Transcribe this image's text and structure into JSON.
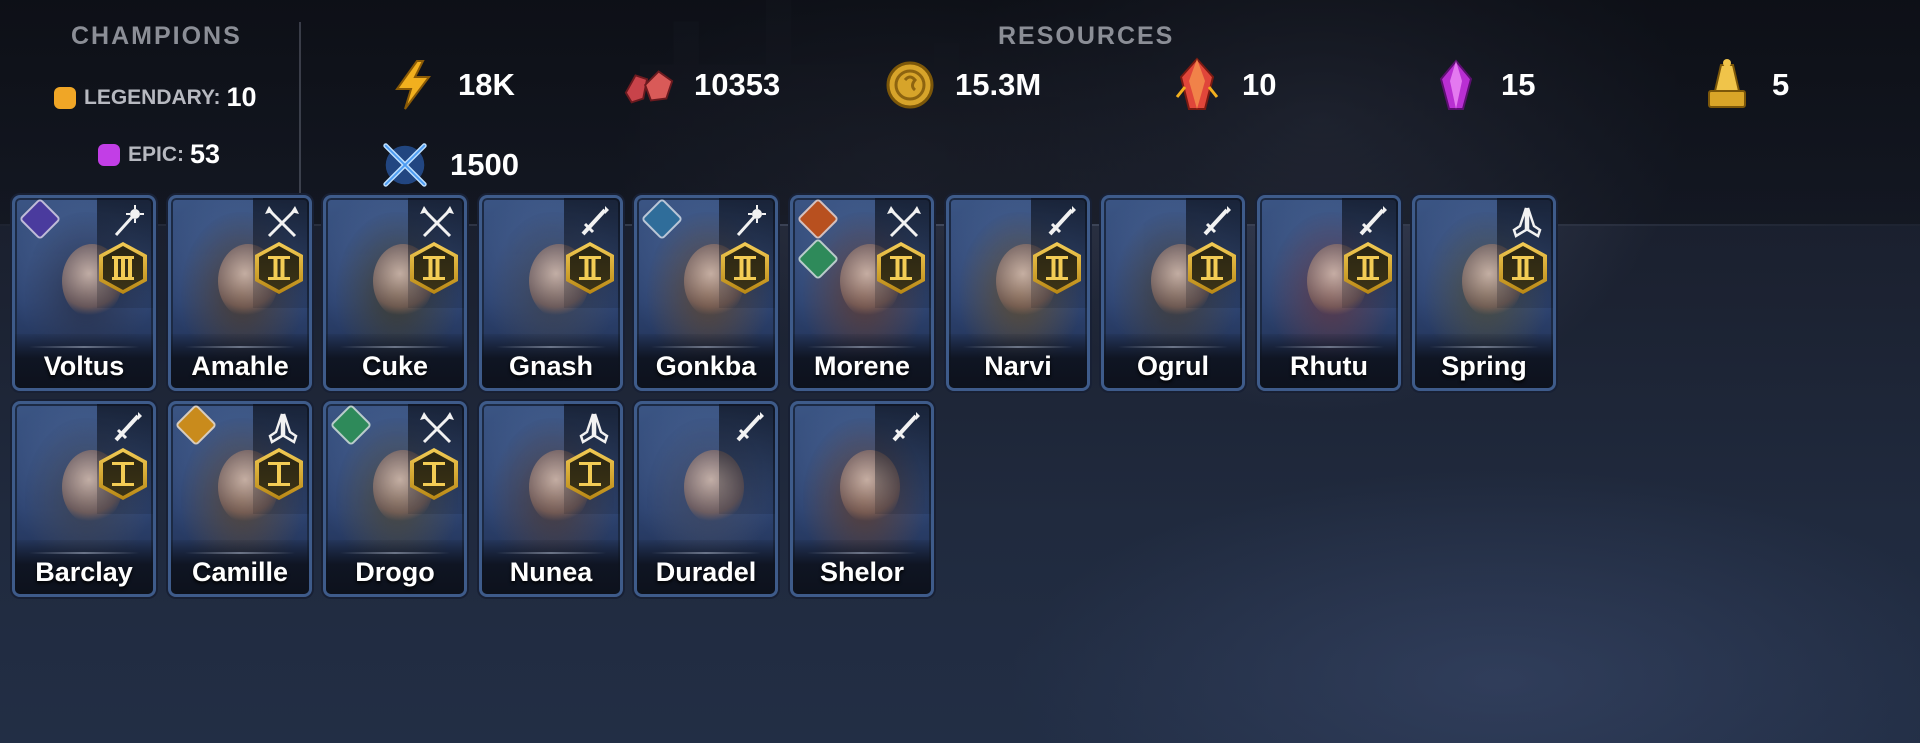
{
  "champions": {
    "title": "CHAMPIONS",
    "legendary": {
      "label": "LEGENDARY:",
      "count": "10",
      "color": "#f0a626"
    },
    "epic": {
      "label": "EPIC:",
      "count": "53",
      "color": "#c23ee6"
    }
  },
  "resources": {
    "title": "RESOURCES",
    "items": [
      {
        "name": "energy",
        "icon": "lightning-icon",
        "value": "18K"
      },
      {
        "name": "rubies",
        "icon": "ruby-icon",
        "value": "10353"
      },
      {
        "name": "silver",
        "icon": "coin-icon",
        "value": "15.3M"
      },
      {
        "name": "red-forge-shard",
        "icon": "red-crystal-icon",
        "value": "10"
      },
      {
        "name": "purple-shard",
        "icon": "purple-crystal-icon",
        "value": "15"
      },
      {
        "name": "gold-item",
        "icon": "gold-trophy-icon",
        "value": "5"
      },
      {
        "name": "arena-tokens",
        "icon": "crossed-swords-icon",
        "value": "1500"
      }
    ]
  },
  "roster": [
    {
      "name": "Voltus",
      "class": "wand-icon",
      "rank": "III",
      "affinity": "magic",
      "affinity2": null,
      "tint": "#27304a"
    },
    {
      "name": "Amahle",
      "class": "spear-icon",
      "rank": "II",
      "affinity": null,
      "affinity2": null,
      "tint": "#4a3a2c"
    },
    {
      "name": "Cuke",
      "class": "spear-icon",
      "rank": "II",
      "affinity": null,
      "affinity2": null,
      "tint": "#3d3a2a"
    },
    {
      "name": "Gnash",
      "class": "sword-icon",
      "rank": "II",
      "affinity": null,
      "affinity2": null,
      "tint": "#3b4150"
    },
    {
      "name": "Gonkba",
      "class": "wand-icon",
      "rank": "II",
      "affinity": "void",
      "affinity2": null,
      "tint": "#5a4430"
    },
    {
      "name": "Morene",
      "class": "spear-icon",
      "rank": "II",
      "affinity": "force",
      "affinity2": "spirit",
      "tint": "#5b3a32"
    },
    {
      "name": "Narvi",
      "class": "sword-icon",
      "rank": "II",
      "affinity": null,
      "affinity2": null,
      "tint": "#5c4a2e"
    },
    {
      "name": "Ogrul",
      "class": "sword-icon",
      "rank": "II",
      "affinity": null,
      "affinity2": null,
      "tint": "#3f3a34"
    },
    {
      "name": "Rhutu",
      "class": "sword-icon",
      "rank": "II",
      "affinity": null,
      "affinity2": null,
      "tint": "#5b3644"
    },
    {
      "name": "Spring",
      "class": "praying-hands-icon",
      "rank": "II",
      "affinity": null,
      "affinity2": null,
      "tint": "#4a4a3a"
    },
    {
      "name": "Barclay",
      "class": "sword-icon",
      "rank": "I",
      "affinity": null,
      "affinity2": null,
      "tint": "#3a4050"
    },
    {
      "name": "Camille",
      "class": "praying-hands-icon",
      "rank": "I",
      "affinity": "spirit-gold",
      "affinity2": null,
      "tint": "#554434"
    },
    {
      "name": "Drogo",
      "class": "spear-icon",
      "rank": "I",
      "affinity": "spirit",
      "affinity2": null,
      "tint": "#4a4638"
    },
    {
      "name": "Nunea",
      "class": "praying-hands-icon",
      "rank": "I",
      "affinity": null,
      "affinity2": null,
      "tint": "#4a3a38"
    },
    {
      "name": "Duradel",
      "class": "sword-icon",
      "rank": null,
      "affinity": null,
      "affinity2": null,
      "tint": "#3c4660"
    },
    {
      "name": "Shelor",
      "class": "sword-icon",
      "rank": null,
      "affinity": null,
      "affinity2": null,
      "tint": "#5a3c30"
    }
  ],
  "colors": {
    "card_border": "#3e5b8a",
    "rank_gold": "#f3cc55",
    "header_text": "#8b8e96"
  }
}
